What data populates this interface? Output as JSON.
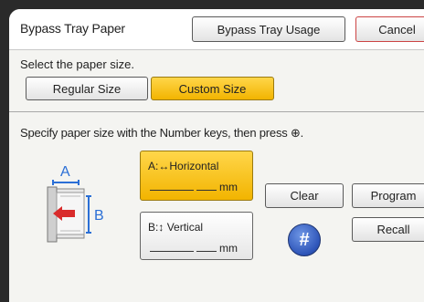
{
  "header": {
    "title": "Bypass Tray Paper",
    "usage_button": "Bypass Tray Usage",
    "cancel_button": "Cancel"
  },
  "paper_size": {
    "prompt": "Select the paper size.",
    "options": [
      "Regular Size",
      "Custom Size"
    ],
    "selected": "Custom Size"
  },
  "custom": {
    "instruction": "Specify paper size with the Number keys, then press ⊕.",
    "horizontal": {
      "letter": "A",
      "arrow": "↔",
      "label": "Horizontal",
      "unit": "mm"
    },
    "vertical": {
      "letter": "B",
      "arrow": "↕",
      "label": "Vertical",
      "unit": "mm"
    },
    "clear_button": "Clear",
    "program_button": "Program",
    "recall_button": "Recall",
    "hash_key": "#"
  },
  "diagram_labels": {
    "a": "A",
    "b": "B"
  },
  "colors": {
    "selected": "#f2b400",
    "hash_key": "#2d54b8",
    "diagram_blue": "#2b6fd6",
    "diagram_arrow": "#d92b2b"
  }
}
